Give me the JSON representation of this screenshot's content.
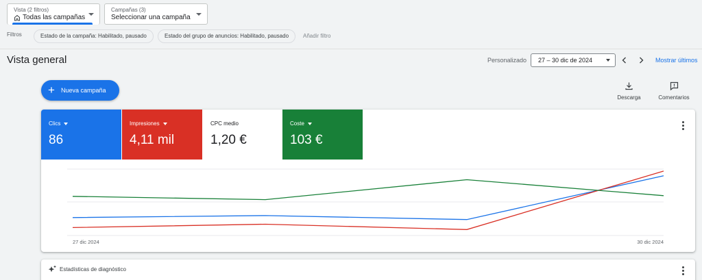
{
  "view_selector": {
    "label": "Vista (2 filtros)",
    "value": "Todas las campañas"
  },
  "campaign_selector": {
    "label": "Campañas (3)",
    "value": "Seleccionar una campaña"
  },
  "filters": {
    "label": "Filtros",
    "chips": [
      "Estado de la campaña: Habilitado, pausado",
      "Estado del grupo de anuncios: Habilitado, pausado"
    ],
    "add_filter": "Añadir filtro"
  },
  "overview": {
    "title": "Vista general",
    "date_mode": "Personalizado",
    "date_range": "27 – 30 dic de 2024",
    "show_last": "Mostrar últimos"
  },
  "actions": {
    "new_campaign": "Nueva campaña",
    "download": "Descarga",
    "feedback": "Comentarios"
  },
  "metrics": [
    {
      "label": "Clics",
      "value": "86",
      "color": "#1a73e8"
    },
    {
      "label": "Impresiones",
      "value": "4,11 mil",
      "color": "#d93025"
    },
    {
      "label": "CPC medio",
      "value": "1,20 €",
      "color": "#ffffff"
    },
    {
      "label": "Coste",
      "value": "103 €",
      "color": "#188038"
    }
  ],
  "chart_data": {
    "type": "line",
    "x": [
      "27 dic 2024",
      "28 dic 2024",
      "29 dic 2024",
      "30 dic 2024"
    ],
    "tick_labels": [
      "27 dic 2024",
      "30 dic 2024"
    ],
    "ylim": [
      0,
      1
    ],
    "grid": true,
    "series": [
      {
        "name": "Clics",
        "color": "#1a73e8",
        "values": [
          0.27,
          0.3,
          0.24,
          0.9
        ]
      },
      {
        "name": "Impresiones",
        "color": "#d93025",
        "values": [
          0.12,
          0.17,
          0.09,
          0.97
        ]
      },
      {
        "name": "Coste",
        "color": "#188038",
        "values": [
          0.59,
          0.54,
          0.84,
          0.6
        ]
      }
    ]
  },
  "diagnostics": {
    "label": "Estadísticas de diagnóstico"
  }
}
